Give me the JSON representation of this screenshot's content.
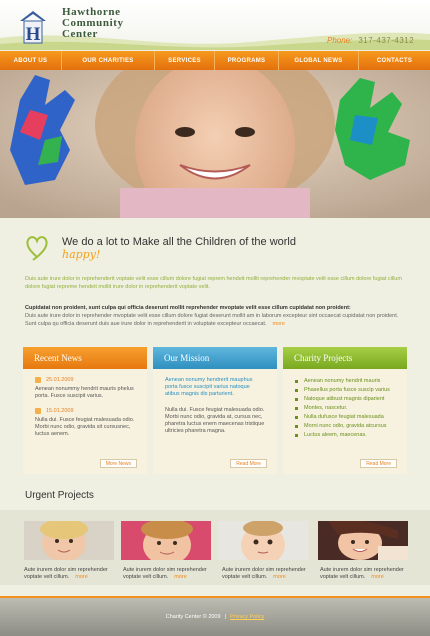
{
  "brand": {
    "name_line1": "Hawthorne",
    "name_line2": "Community",
    "name_line3": "Center",
    "phone_label": "Phone:",
    "phone_number": "317-437-4312"
  },
  "nav": [
    "ABOUT US",
    "OUR CHARITIES",
    "SERVICES",
    "PROGRAMS",
    "GLOBAL NEWS",
    "CONTACTS"
  ],
  "intro": {
    "title": "We do a lot to Make all the Children of the world",
    "title_accent": "happy!",
    "para1": "Duis aute irure dolor in reprehenderit voptate velit esse cillum dolore fugiat reprem hendeit mollit reprehender mvoptate velit esse cillum dolore fugiat cillum dolore fugiat repreme hendeit mollit irure dolor in reprehenderit voptate velit.",
    "strong": "Cupidatat non proident, sunt culpa qui officia deserunt mollit reprehender mvoptate velit esse cillum cupidatat non proident:",
    "para2": "Duis aute irure dolor in reprehender mvoptate velit esse cillum dolore fugiat deserunt mollit am in laborum excepteur sint occaecat cupidatat non proident. Sunt culpa qu officia deserunt duis aue irure dolor in reprehenderit in voluptate excepteur occaecat.",
    "more": "more"
  },
  "recent_news": {
    "title": "Recent News",
    "items": [
      {
        "date": "25.01.2009",
        "text": "Aenean nonummy hendrit mauris phelus porta. Fusce suscipit varius."
      },
      {
        "date": "15.01.2009",
        "text": "Nulla dui. Fusce feugiat malesuada odio. Morbi nunc odio, gravida sit cursusnec, luctus aenem."
      }
    ],
    "button": "More News"
  },
  "our_mission": {
    "title": "Our Mission",
    "lead": "Aenean nonumy hendrerit mauphus porta fusce suscipit varius natoque atibus magnis dis parturient.",
    "text": "Nulla dui. Fusce feugiat malesuada odio. Morbi nunc odio, gravida at, cursus nec, pharetra luctus enem maecenas tristique ultricies pharetra magna.",
    "button": "Read More"
  },
  "charity_projects": {
    "title": "Charity Projects",
    "items": [
      "Aenean nonumy hendrit mauris",
      "Phasellus porta fusce suscip varius",
      "Natoque atibust magnis diparient",
      "Montes, nascetur.",
      "Nulla dufusce feugiat malesuada",
      "Morni nunc odio, gravida atcursus",
      "Luctus aleem, maecenas."
    ],
    "button": "Read More"
  },
  "urgent": {
    "title": "Urgent Projects",
    "items": [
      {
        "caption": "Aute irurem dolor sim reprehender voptate velt cillum.",
        "more": "more"
      },
      {
        "caption": "Aute irurem dolor sim reprehender voptate velt cillum.",
        "more": "more"
      },
      {
        "caption": "Aute irurem dolor sim reprehender voptate velt cillum.",
        "more": "more"
      },
      {
        "caption": "Aute irurem dolor sim reprehender voptate velt cillum.",
        "more": "more"
      }
    ]
  },
  "footer": {
    "copyright": "Charity Center © 2009",
    "separator": "|",
    "privacy": "Privacy Policy"
  },
  "colors": {
    "accent_orange": "#f08a1a",
    "mission_blue": "#3fa2d0",
    "charity_green": "#8cbb2c",
    "intro_green": "#8fb03a"
  },
  "icons": [
    "house-logo-icon",
    "heart-icon",
    "date-icon",
    "bullet-icon"
  ]
}
